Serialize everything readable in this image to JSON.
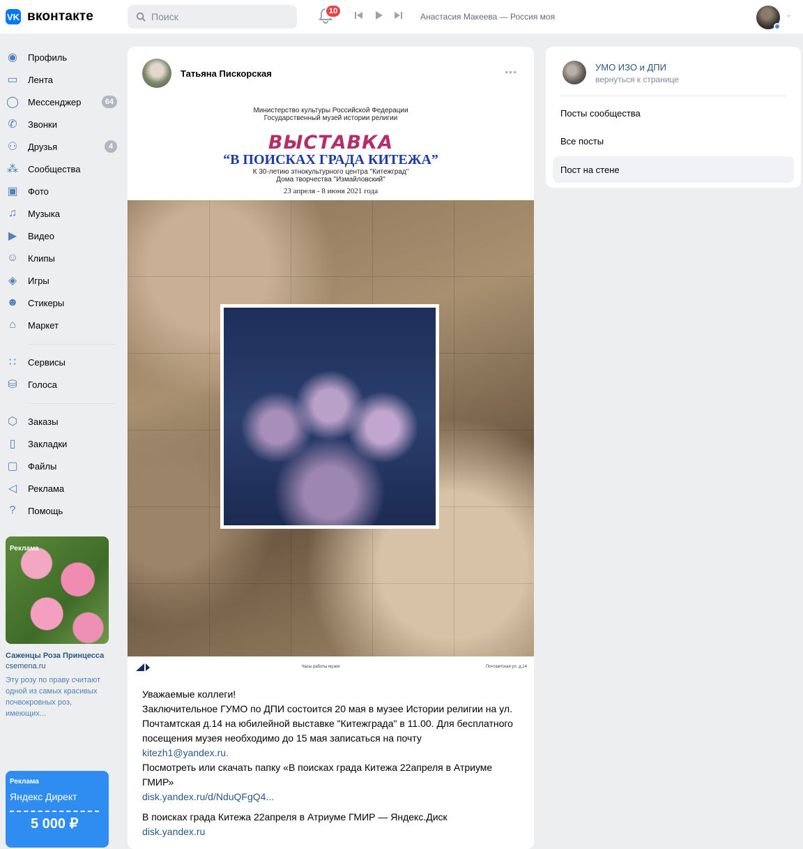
{
  "header": {
    "logo_text": "вконтакте",
    "logo_letter": "VK",
    "search_placeholder": "Поиск",
    "notifications_count": "10",
    "track": "Анастасия Макеева — Россия моя"
  },
  "nav": {
    "items": [
      {
        "label": "Профиль",
        "icon": "profile-icon"
      },
      {
        "label": "Лента",
        "icon": "feed-icon"
      },
      {
        "label": "Мессенджер",
        "icon": "messenger-icon",
        "count": "64"
      },
      {
        "label": "Звонки",
        "icon": "phone-icon"
      },
      {
        "label": "Друзья",
        "icon": "friends-icon",
        "count": "4"
      },
      {
        "label": "Сообщества",
        "icon": "communities-icon"
      },
      {
        "label": "Фото",
        "icon": "photo-icon"
      },
      {
        "label": "Музыка",
        "icon": "music-icon"
      },
      {
        "label": "Видео",
        "icon": "video-icon"
      },
      {
        "label": "Клипы",
        "icon": "clips-icon"
      },
      {
        "label": "Игры",
        "icon": "games-icon"
      },
      {
        "label": "Стикеры",
        "icon": "stickers-icon"
      },
      {
        "label": "Маркет",
        "icon": "market-icon"
      }
    ],
    "group2": [
      {
        "label": "Сервисы",
        "icon": "services-icon"
      },
      {
        "label": "Голоса",
        "icon": "votes-icon"
      }
    ],
    "group3": [
      {
        "label": "Заказы",
        "icon": "orders-icon"
      },
      {
        "label": "Закладки",
        "icon": "bookmarks-icon"
      },
      {
        "label": "Файлы",
        "icon": "files-icon"
      },
      {
        "label": "Реклама",
        "icon": "ads-icon"
      },
      {
        "label": "Помощь",
        "icon": "help-icon"
      }
    ]
  },
  "ad1": {
    "tag": "Реклама",
    "title": "Саженцы Роза Принцесса",
    "domain": "csemena.ru",
    "text": "Эту розу по праву считают одной из самых красивых почвокровных роз, имеющих..."
  },
  "ad2": {
    "tag": "Реклама",
    "brand": "Яндекс Директ",
    "price": "5 000 ₽"
  },
  "post": {
    "author": "Татьяна Пискорская",
    "more": "•••",
    "poster": {
      "ministry_line1": "Министерство культуры Российской Федерации",
      "ministry_line2": "Государственный музей истории религии",
      "title": "ВЫСТАВКА",
      "subtitle": "“В ПОИСКАХ ГРАДА КИТЕЖА”",
      "ann_line1": "К 30-летию этнокультурного центра \"Китежград\"",
      "ann_line2": "Дома творчества \"Измайловский\"",
      "dates": "23 апреля - 8 июня 2021 года",
      "footer_mid": "Часы работы музея",
      "footer_right": "Почтамтская ул. д.14"
    },
    "body": {
      "greeting": "Уважаемые коллеги!",
      "text": "Заключительное ГУМО по ДПИ состоится 20 мая в музее Истории религии на ул. Почтамтская д.14 на юбилейной выставке \"Китежграда\" в 11.00. Для бесплатного посещения музея необходимо до 15 мая записаться на почту",
      "email": "kitezh1@yandex.ru.",
      "text2": "Посмотреть или скачать папку «В поисках града Китежа 22апреля в Атриуме ГМИР»",
      "link1": "disk.yandex.ru/d/NduQFgQ4...",
      "text3": "В поисках града Китежа 22апреля в Атриуме ГМИР — Яндекс.Диск",
      "link2": "disk.yandex.ru"
    }
  },
  "side": {
    "name": "УМО ИЗО и ДПИ",
    "back": "вернуться к странице",
    "links": [
      "Посты сообщества",
      "Все посты",
      "Пост на стене"
    ],
    "active_index": 2
  },
  "colors": {
    "accent": "#0077ff",
    "link": "#2a5885",
    "badge": "#e64646",
    "bg": "#edeef0"
  }
}
